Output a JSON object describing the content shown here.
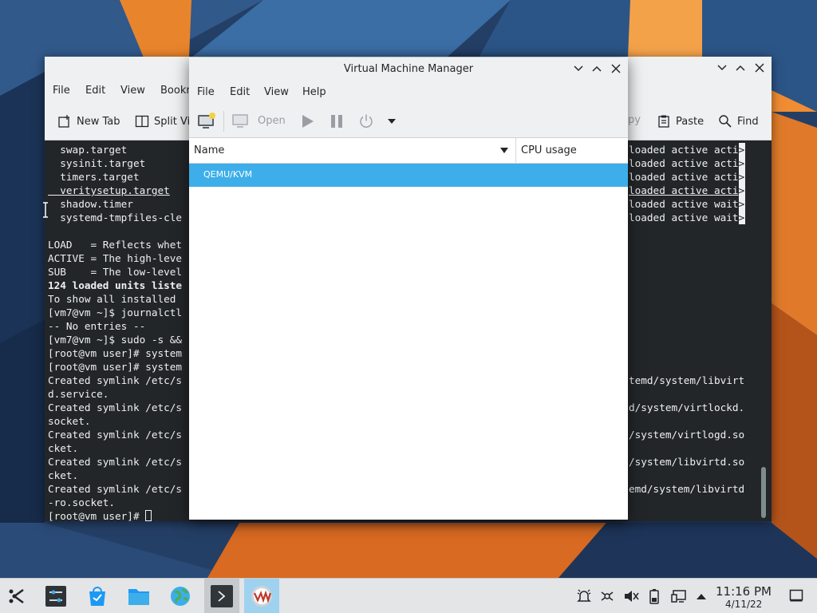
{
  "konsole": {
    "menu": [
      "File",
      "Edit",
      "View",
      "Bookm"
    ],
    "toolbar": {
      "new_tab": "New Tab",
      "split_view": "Split Vie",
      "copy": "py",
      "paste": "Paste",
      "find": "Find"
    },
    "left_lines": [
      {
        "text": "  swap.target",
        "style": "normal"
      },
      {
        "text": "  sysinit.target",
        "style": "normal"
      },
      {
        "text": "  timers.target",
        "style": "normal"
      },
      {
        "text": "  veritysetup.target",
        "style": "underline"
      },
      {
        "text": "  shadow.timer",
        "style": "normal"
      },
      {
        "text": "  systemd-tmpfiles-cle",
        "style": "normal"
      },
      {
        "text": "",
        "style": "normal"
      },
      {
        "text": "LOAD   = Reflects whet",
        "style": "normal"
      },
      {
        "text": "ACTIVE = The high-leve",
        "style": "normal"
      },
      {
        "text": "SUB    = The low-level",
        "style": "normal"
      },
      {
        "text": "124 loaded units liste",
        "style": "bold"
      },
      {
        "text": "To show all installed ",
        "style": "normal"
      },
      {
        "text": "[vm7@vm ~]$ journalctl",
        "style": "normal"
      },
      {
        "text": "-- No entries --",
        "style": "normal"
      },
      {
        "text": "[vm7@vm ~]$ sudo -s &&",
        "style": "normal"
      },
      {
        "text": "[root@vm user]# system",
        "style": "normal"
      },
      {
        "text": "[root@vm user]# system",
        "style": "normal"
      },
      {
        "text": "Created symlink /etc/s",
        "style": "normal"
      },
      {
        "text": "d.service.",
        "style": "normal"
      },
      {
        "text": "Created symlink /etc/s",
        "style": "normal"
      },
      {
        "text": "socket.",
        "style": "normal"
      },
      {
        "text": "Created symlink /etc/s",
        "style": "normal"
      },
      {
        "text": "cket.",
        "style": "normal"
      },
      {
        "text": "Created symlink /etc/s",
        "style": "normal"
      },
      {
        "text": "cket.",
        "style": "normal"
      },
      {
        "text": "Created symlink /etc/s",
        "style": "normal"
      },
      {
        "text": "-ro.socket.",
        "style": "normal"
      },
      {
        "text": "[root@vm user]# ",
        "style": "prompt"
      }
    ],
    "right_lines": [
      {
        "row": 0,
        "text": "loaded active acti",
        "gt": ">"
      },
      {
        "row": 1,
        "text": "loaded active acti",
        "gt": ">"
      },
      {
        "row": 2,
        "text": "loaded active acti",
        "gt": ">"
      },
      {
        "row": 3,
        "text": "loaded active acti",
        "gt": ">"
      },
      {
        "row": 4,
        "text": "loaded active wait",
        "gt": ">"
      },
      {
        "row": 5,
        "text": "loaded active wait",
        "gt": ">"
      },
      {
        "row": 17,
        "text": "temd/system/libvirt",
        "gt": ""
      },
      {
        "row": 19,
        "text": "d/system/virtlockd.",
        "gt": ""
      },
      {
        "row": 21,
        "text": "/system/virtlogd.so",
        "gt": ""
      },
      {
        "row": 23,
        "text": "/system/libvirtd.so",
        "gt": ""
      },
      {
        "row": 25,
        "text": "emd/system/libvirtd",
        "gt": ""
      }
    ]
  },
  "vmm": {
    "title": "Virtual Machine Manager",
    "menu": [
      "File",
      "Edit",
      "View",
      "Help"
    ],
    "toolbar": {
      "open_label": "Open"
    },
    "columns": {
      "name": "Name",
      "cpu": "CPU usage"
    },
    "connections": [
      {
        "name": "QEMU/KVM",
        "selected": true
      }
    ]
  },
  "taskbar": {
    "clock_time": "11:16 PM",
    "clock_date": "4/11/22"
  },
  "colors": {
    "selection": "#3daee9",
    "terminal_bg": "#232629",
    "window_chrome": "#eff0f1"
  }
}
